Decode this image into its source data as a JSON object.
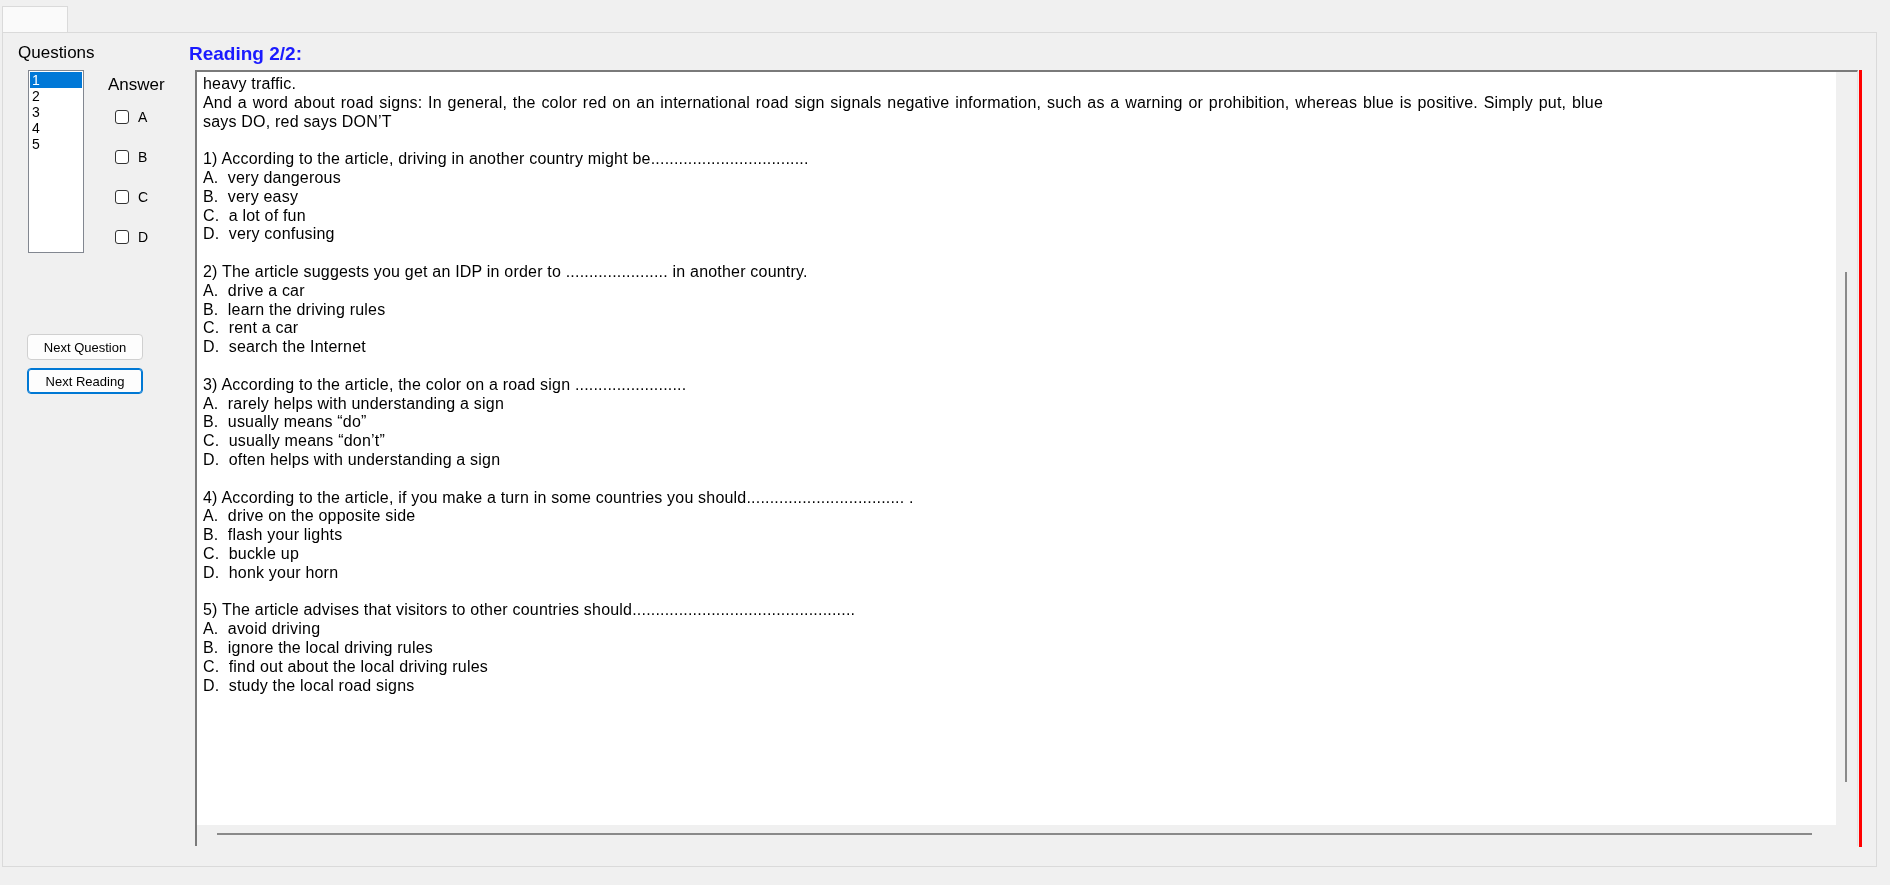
{
  "questions_list": {
    "label": "Questions",
    "items": [
      {
        "label": "1",
        "selected": true
      },
      {
        "label": "2",
        "selected": false
      },
      {
        "label": "3",
        "selected": false
      },
      {
        "label": "4",
        "selected": false
      },
      {
        "label": "5",
        "selected": false
      }
    ]
  },
  "answer_panel": {
    "label": "Answer",
    "options": [
      {
        "label": "A",
        "checked": false
      },
      {
        "label": "B",
        "checked": false
      },
      {
        "label": "C",
        "checked": false
      },
      {
        "label": "D",
        "checked": false
      }
    ]
  },
  "next_question_button": {
    "label": "Next Question",
    "focused": false
  },
  "next_reading_button": {
    "label": "Next Reading",
    "focused": true
  },
  "reading": {
    "title": "Reading 2/2:",
    "passage": [
      "heavy traffic.",
      "And a word about road signs: In general, the color red on an international road sign signals negative information, such as a warning or prohibition, whereas blue is positive. Simply put, blue says DO, red says DON’T"
    ],
    "questions": [
      {
        "stem": "1) According to the article, driving in another country might be..................................",
        "options": [
          "A.  very dangerous",
          "B.  very easy",
          "C.  a lot of fun",
          "D.  very confusing"
        ]
      },
      {
        "stem": "2) The article suggests you get an IDP in order to ...................... in another country.",
        "options": [
          "A.  drive a car",
          "B.  learn the driving rules",
          "C.  rent a car",
          "D.  search the Internet"
        ]
      },
      {
        "stem": "3) According to the article, the color on a road sign ........................",
        "options": [
          "A.  rarely helps with understanding a sign",
          "B.  usually means “do”",
          "C.  usually means “don’t”",
          "D.  often helps with understanding a sign"
        ]
      },
      {
        "stem": "4) According to the article, if you make a turn in some countries you should.................................. .",
        "options": [
          "A.  drive on the opposite side",
          "B.  flash your lights",
          "C.  buckle up",
          "D.  honk your horn"
        ]
      },
      {
        "stem": "5) The article advises that visitors to other countries should................................................",
        "options": [
          "A.  avoid driving",
          "B.  ignore the local driving rules",
          "C.  find out about the local driving rules",
          "D.  study the local road signs"
        ]
      }
    ]
  }
}
